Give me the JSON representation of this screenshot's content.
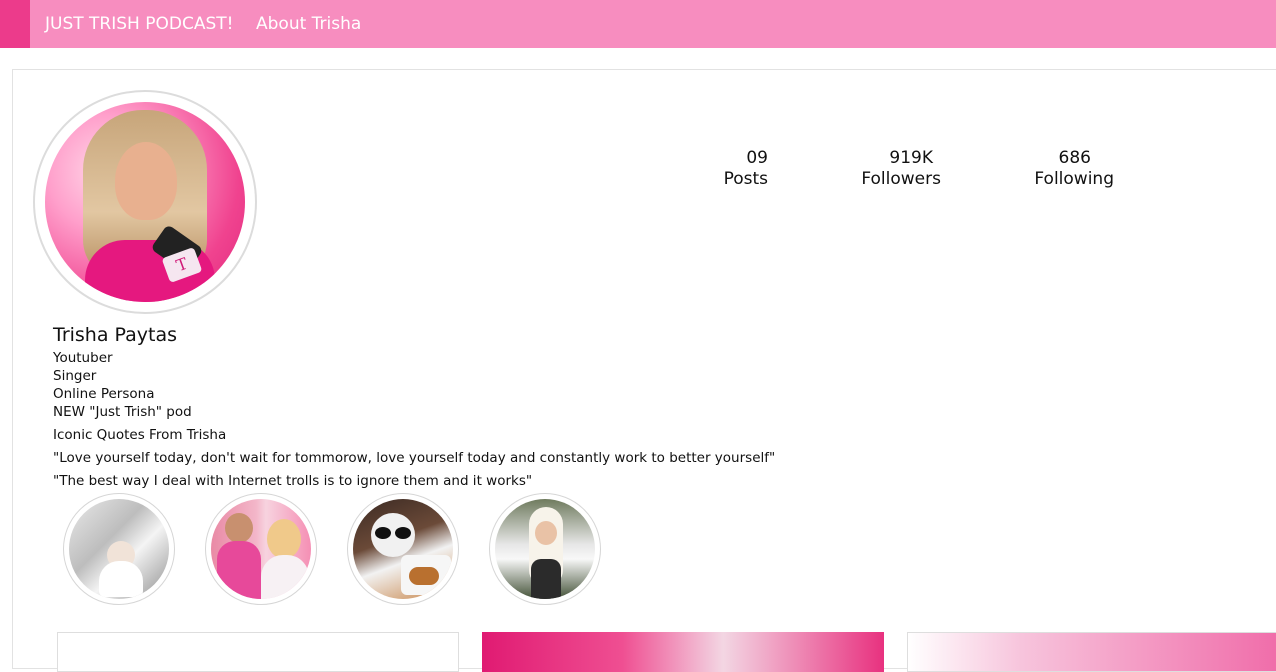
{
  "nav": {
    "podcast_label": "JUST TRISH PODCAST!",
    "about_label": "About Trisha"
  },
  "profile": {
    "name": "Trisha Paytas",
    "bio_lines": [
      "Youtuber",
      "Singer",
      "Online Persona",
      "NEW \"Just Trish\" pod"
    ],
    "quotes_title": "Iconic Quotes From Trisha",
    "quotes": [
      "\"Love yourself today, don't wait for tommorow, love yourself today and constantly work to better yourself\"",
      "\"The best way I deal with Internet trolls is to ignore them and it works\""
    ]
  },
  "stats": {
    "posts": {
      "value": "09",
      "label": "Posts"
    },
    "followers": {
      "value": "919K",
      "label": "Followers"
    },
    "following": {
      "value": "686",
      "label": "Following"
    }
  },
  "colors": {
    "nav_bg": "#f78dbf",
    "nav_accent": "#ec3b8b"
  }
}
